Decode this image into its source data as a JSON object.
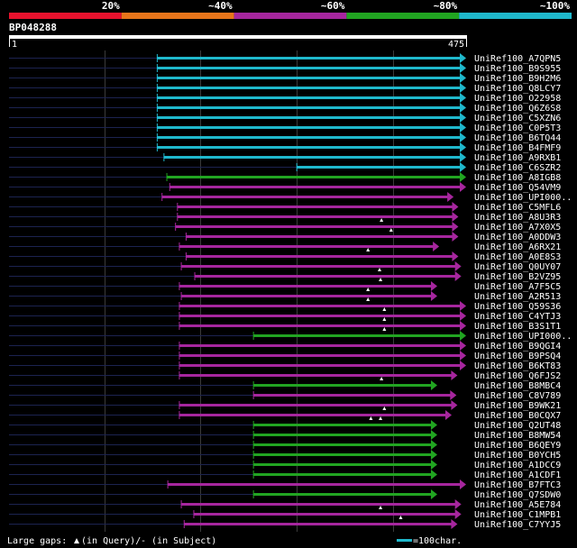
{
  "colors": {
    "background": "#000000",
    "red": "#e8122d",
    "orange": "#e8751a",
    "purple": "#a6269e",
    "green": "#21a521",
    "cyan": "#1fb8cc",
    "text": "#ffffff",
    "grid": "#3a3a3a"
  },
  "legend_scale": [
    {
      "label": "20%",
      "color": "#e8122d"
    },
    {
      "label": "~40%",
      "color": "#e8751a"
    },
    {
      "label": "~60%",
      "color": "#a6269e"
    },
    {
      "label": "~80%",
      "color": "#21a521"
    },
    {
      "label": "~100%",
      "color": "#1fb8cc"
    }
  ],
  "query": {
    "id": "BP048288",
    "start": "1",
    "end": "475",
    "length": 475
  },
  "hits": [
    {
      "name": "UniRef100_A7QPN5",
      "color": "cyan",
      "start": 155,
      "end": 475,
      "arrow": "right",
      "gaps": []
    },
    {
      "name": "UniRef100_B9S955",
      "color": "cyan",
      "start": 155,
      "end": 475,
      "arrow": "right",
      "gaps": []
    },
    {
      "name": "UniRef100_B9H2M6",
      "color": "cyan",
      "start": 155,
      "end": 475,
      "arrow": "right",
      "gaps": []
    },
    {
      "name": "UniRef100_Q8LCY7",
      "color": "cyan",
      "start": 155,
      "end": 475,
      "arrow": "right",
      "gaps": []
    },
    {
      "name": "UniRef100_O22958",
      "color": "cyan",
      "start": 155,
      "end": 475,
      "arrow": "right",
      "gaps": []
    },
    {
      "name": "UniRef100_Q6Z6S8",
      "color": "cyan",
      "start": 155,
      "end": 475,
      "arrow": "right",
      "gaps": []
    },
    {
      "name": "UniRef100_C5XZN6",
      "color": "cyan",
      "start": 155,
      "end": 475,
      "arrow": "right",
      "gaps": []
    },
    {
      "name": "UniRef100_C0P5T3",
      "color": "cyan",
      "start": 155,
      "end": 475,
      "arrow": "right",
      "gaps": []
    },
    {
      "name": "UniRef100_B6TQ44",
      "color": "cyan",
      "start": 155,
      "end": 475,
      "arrow": "right",
      "gaps": []
    },
    {
      "name": "UniRef100_B4FMF9",
      "color": "cyan",
      "start": 155,
      "end": 475,
      "arrow": "right",
      "gaps": []
    },
    {
      "name": "UniRef100_A9RXB1",
      "color": "cyan",
      "start": 162,
      "end": 475,
      "arrow": "right",
      "gaps": []
    },
    {
      "name": "UniRef100_C6SZR2",
      "color": "cyan",
      "start": 300,
      "end": 475,
      "arrow": "right",
      "gaps": []
    },
    {
      "name": "UniRef100_A8IGB8",
      "color": "green",
      "start": 165,
      "end": 475,
      "arrow": "right",
      "gaps": []
    },
    {
      "name": "UniRef100_Q54VM9",
      "color": "purple",
      "start": 168,
      "end": 475,
      "arrow": "right",
      "gaps": []
    },
    {
      "name": "UniRef100_UPI000..",
      "color": "purple",
      "start": 160,
      "end": 462,
      "arrow": "right",
      "gaps": []
    },
    {
      "name": "UniRef100_C5MFL6",
      "color": "purple",
      "start": 176,
      "end": 467,
      "arrow": "right",
      "gaps": []
    },
    {
      "name": "UniRef100_A8U3R3",
      "color": "purple",
      "start": 176,
      "end": 467,
      "arrow": "right",
      "gaps": [
        388
      ]
    },
    {
      "name": "UniRef100_A7X0X5",
      "color": "purple",
      "start": 174,
      "end": 467,
      "arrow": "right",
      "gaps": [
        398
      ]
    },
    {
      "name": "UniRef100_A0DDW3",
      "color": "purple",
      "start": 185,
      "end": 467,
      "arrow": "right",
      "gaps": []
    },
    {
      "name": "UniRef100_A6RX21",
      "color": "purple",
      "start": 178,
      "end": 447,
      "arrow": "right",
      "gaps": [
        374
      ]
    },
    {
      "name": "UniRef100_A0E8S3",
      "color": "purple",
      "start": 185,
      "end": 467,
      "arrow": "right",
      "gaps": []
    },
    {
      "name": "UniRef100_Q0UY07",
      "color": "purple",
      "start": 180,
      "end": 470,
      "arrow": "right",
      "gaps": [
        386
      ]
    },
    {
      "name": "UniRef100_B2VZ95",
      "color": "purple",
      "start": 194,
      "end": 470,
      "arrow": "right",
      "gaps": [
        387
      ]
    },
    {
      "name": "UniRef100_A7F5C5",
      "color": "purple",
      "start": 178,
      "end": 445,
      "arrow": "right",
      "gaps": [
        374
      ]
    },
    {
      "name": "UniRef100_A2R513",
      "color": "purple",
      "start": 180,
      "end": 445,
      "arrow": "right",
      "gaps": [
        374
      ]
    },
    {
      "name": "UniRef100_Q59S36",
      "color": "purple",
      "start": 178,
      "end": 475,
      "arrow": "right",
      "gaps": [
        391
      ]
    },
    {
      "name": "UniRef100_C4YTJ3",
      "color": "purple",
      "start": 178,
      "end": 475,
      "arrow": "right",
      "gaps": [
        391
      ]
    },
    {
      "name": "UniRef100_B3S1T1",
      "color": "purple",
      "start": 178,
      "end": 475,
      "arrow": "right",
      "gaps": [
        391
      ]
    },
    {
      "name": "UniRef100_UPI000..",
      "color": "green",
      "start": 255,
      "end": 475,
      "arrow": "right",
      "gaps": []
    },
    {
      "name": "UniRef100_B9QGI4",
      "color": "purple",
      "start": 178,
      "end": 475,
      "arrow": "right",
      "gaps": []
    },
    {
      "name": "UniRef100_B9PSQ4",
      "color": "purple",
      "start": 178,
      "end": 475,
      "arrow": "right",
      "gaps": []
    },
    {
      "name": "UniRef100_B6KT83",
      "color": "purple",
      "start": 178,
      "end": 475,
      "arrow": "right",
      "gaps": []
    },
    {
      "name": "UniRef100_Q6FJS2",
      "color": "purple",
      "start": 178,
      "end": 466,
      "arrow": "right",
      "gaps": [
        388
      ]
    },
    {
      "name": "UniRef100_B8MBC4",
      "color": "green",
      "start": 255,
      "end": 445,
      "arrow": "right",
      "gaps": []
    },
    {
      "name": "UniRef100_C8V789",
      "color": "purple",
      "start": 255,
      "end": 465,
      "arrow": "right",
      "gaps": []
    },
    {
      "name": "UniRef100_B9WK21",
      "color": "purple",
      "start": 178,
      "end": 466,
      "arrow": "right",
      "gaps": [
        391
      ]
    },
    {
      "name": "UniRef100_B0CQX7",
      "color": "purple",
      "start": 178,
      "end": 460,
      "arrow": "right",
      "gaps": [
        377,
        387
      ]
    },
    {
      "name": "UniRef100_Q2UT48",
      "color": "green",
      "start": 255,
      "end": 445,
      "arrow": "right",
      "gaps": []
    },
    {
      "name": "UniRef100_B8MW54",
      "color": "green",
      "start": 255,
      "end": 445,
      "arrow": "right",
      "gaps": []
    },
    {
      "name": "UniRef100_B6QEY9",
      "color": "green",
      "start": 255,
      "end": 445,
      "arrow": "right",
      "gaps": []
    },
    {
      "name": "UniRef100_B0YCH5",
      "color": "green",
      "start": 255,
      "end": 445,
      "arrow": "right",
      "gaps": []
    },
    {
      "name": "UniRef100_A1DCC9",
      "color": "green",
      "start": 255,
      "end": 445,
      "arrow": "right",
      "gaps": []
    },
    {
      "name": "UniRef100_A1CDF1",
      "color": "green",
      "start": 255,
      "end": 445,
      "arrow": "right",
      "gaps": []
    },
    {
      "name": "UniRef100_B7FTC3",
      "color": "purple",
      "start": 166,
      "end": 475,
      "arrow": "right",
      "gaps": []
    },
    {
      "name": "UniRef100_Q7SDW0",
      "color": "green",
      "start": 255,
      "end": 445,
      "arrow": "right",
      "gaps": []
    },
    {
      "name": "UniRef100_A5E784",
      "color": "purple",
      "start": 180,
      "end": 470,
      "arrow": "right",
      "gaps": [
        387
      ]
    },
    {
      "name": "UniRef100_C1MPB1",
      "color": "purple",
      "start": 193,
      "end": 470,
      "arrow": "right",
      "gaps": [
        408
      ]
    },
    {
      "name": "UniRef100_C7YYJ5",
      "color": "purple",
      "start": 183,
      "end": 466,
      "arrow": "right",
      "gaps": []
    }
  ],
  "footer": {
    "gaps_label": "Large gaps:",
    "in_query": "(in Query)/",
    "in_subject": "- (in Subject)",
    "scale_label": "=100char."
  }
}
